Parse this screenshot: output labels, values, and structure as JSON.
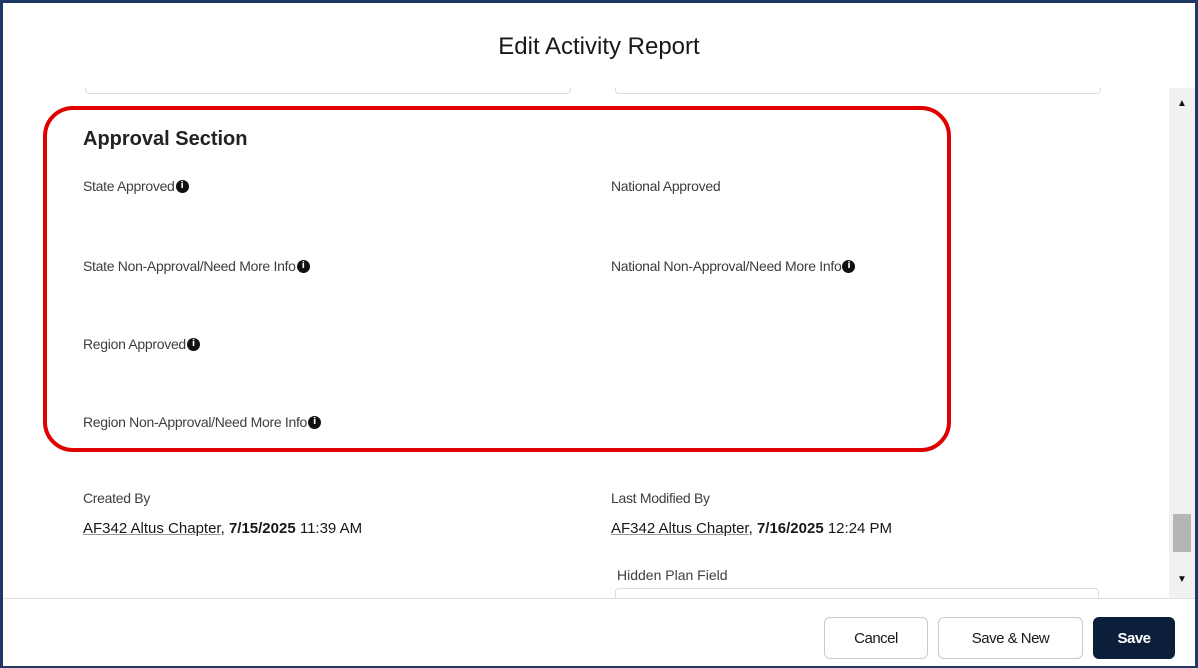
{
  "modal": {
    "title": "Edit Activity Report"
  },
  "approval_section": {
    "title": "Approval Section",
    "fields": {
      "state_approved": "State Approved",
      "national_approved": "National Approved",
      "state_non_approval": "State Non-Approval/Need More Info",
      "national_non_approval": "National Non-Approval/Need More Info",
      "region_approved": "Region Approved",
      "region_non_approval": "Region Non-Approval/Need More Info"
    },
    "info_icon_glyph": "i"
  },
  "system_info": {
    "created_by_label": "Created By",
    "created_by_user": "AF342 Altus Chapter",
    "created_by_date": "7/15/2025",
    "created_by_time": "11:39 AM",
    "last_modified_label": "Last Modified By",
    "last_modified_user": "AF342 Altus Chapter",
    "last_modified_date": "7/16/2025",
    "last_modified_time": "12:24 PM"
  },
  "hidden_plan": {
    "label": "Hidden Plan Field",
    "value": ""
  },
  "footer": {
    "cancel_label": "Cancel",
    "save_new_label": "Save & New",
    "save_label": "Save"
  },
  "icons": {
    "info": "info-icon",
    "scroll_up": "caret-up-icon",
    "scroll_down": "caret-down-icon"
  },
  "colors": {
    "frame_border": "#1f3864",
    "highlight": "#e00000",
    "save_button": "#0b1f3a"
  }
}
